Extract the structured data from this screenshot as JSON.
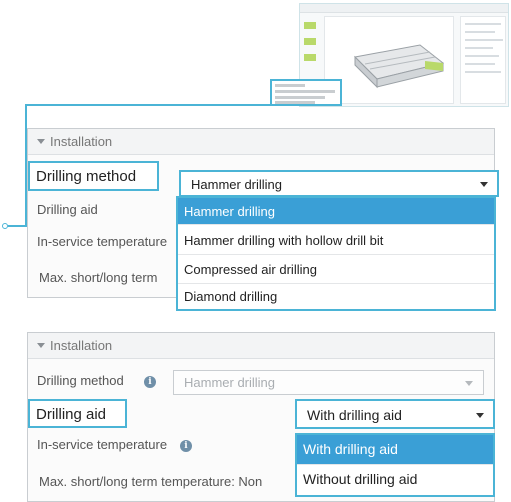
{
  "colors": {
    "highlight": "#4bb4d6",
    "selected_option_bg": "#3a9fd6",
    "thumbnail_accent": "#b9d96a"
  },
  "thumbnail": {
    "description_icon": "app-screenshot-thumbnail"
  },
  "panel_top": {
    "section_title": "Installation",
    "drilling_method_label": "Drilling method",
    "drilling_method_value": "Hammer drilling",
    "drilling_aid_label": "Drilling aid",
    "service_temp_label": "In-service temperature",
    "max_temp_label": "Max. short/long term",
    "options": [
      "Hammer drilling",
      "Hammer drilling with hollow drill bit",
      "Compressed air drilling",
      "Diamond drilling"
    ],
    "selected_index": 0
  },
  "panel_bottom": {
    "section_title": "Installation",
    "drilling_method_label": "Drilling method",
    "drilling_method_value": "Hammer drilling",
    "drilling_aid_label": "Drilling aid",
    "drilling_aid_value": "With drilling aid",
    "service_temp_label": "In-service temperature",
    "max_temp_label": "Max. short/long term temperature: Non",
    "options": [
      "With drilling aid",
      "Without drilling aid"
    ],
    "selected_index": 0
  }
}
